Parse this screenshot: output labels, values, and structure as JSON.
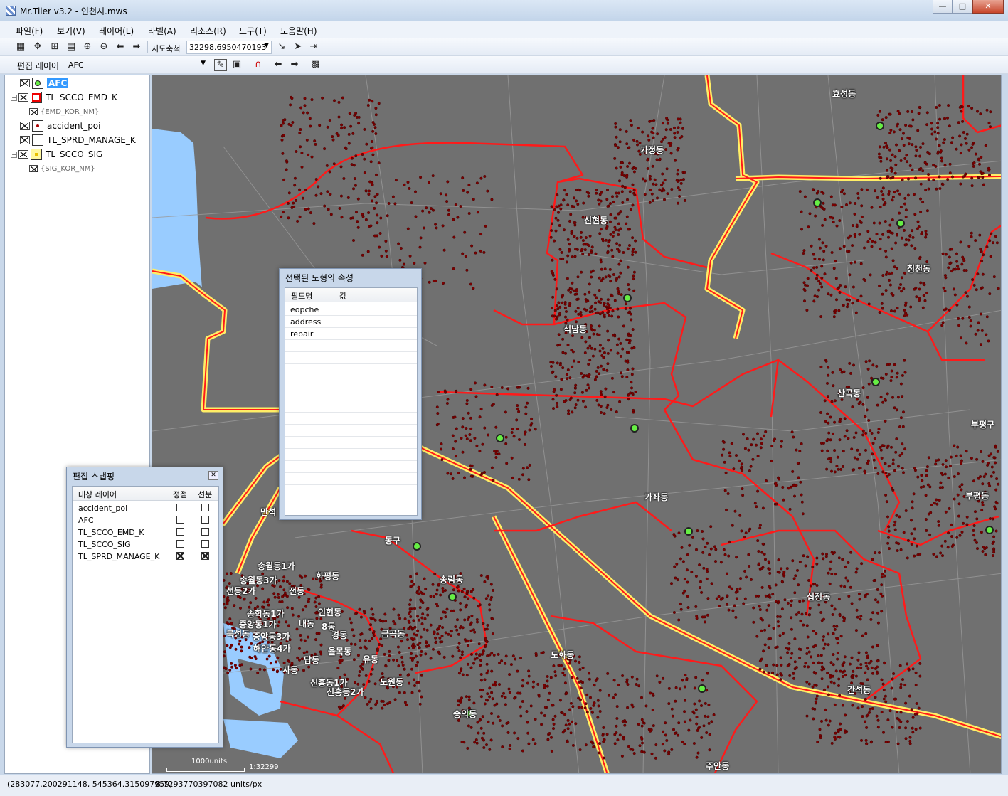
{
  "window": {
    "title": "Mr.Tiler v3.2 - 인천시.mws",
    "buttons": [
      "minimize",
      "maximize",
      "close"
    ]
  },
  "menu": [
    "파일(F)",
    "보기(V)",
    "레이어(L)",
    "라벨(A)",
    "리소스(R)",
    "도구(T)",
    "도움말(H)"
  ],
  "toolbar1": {
    "scale_label": "지도축척",
    "scale_value": "32298.6950470193",
    "icons": [
      "select-extent-icon",
      "pan-icon",
      "grid-icon",
      "table-icon",
      "zoom-in-icon",
      "zoom-out-icon",
      "back-icon",
      "forward-icon"
    ]
  },
  "toolbar2": {
    "edit_layer_label": "편집 레이어",
    "edit_layer_value": "AFC"
  },
  "layers": [
    {
      "name": "AFC",
      "selected": true,
      "symbol": "green-point"
    },
    {
      "name": "TL_SCCO_EMD_K",
      "symbol": "red-polygon",
      "expanded": true,
      "sublabel": "{EMD_KOR_NM}"
    },
    {
      "name": "accident_poi",
      "symbol": "red-point"
    },
    {
      "name": "TL_SPRD_MANAGE_K",
      "symbol": "empty"
    },
    {
      "name": "TL_SCCO_SIG",
      "symbol": "yellow-polygon",
      "expanded": true,
      "sublabel": "{SIG_KOR_NM}"
    }
  ],
  "map": {
    "labels": [
      "효성동",
      "가정동",
      "신현동",
      "청천동",
      "석남동",
      "산곡동",
      "부평구",
      "가좌동",
      "부평동",
      "송림동",
      "십정동",
      "도화동",
      "간석동",
      "숭의동",
      "주안동",
      "만석",
      "동구",
      "송월동1가",
      "송월동3가",
      "화평동",
      "선동2가",
      "전동",
      "송학동1가",
      "인현동",
      "중앙동1가",
      "내동",
      "8동",
      "중앙동3가",
      "경동",
      "해안동4가",
      "금곡동",
      "북성동",
      "답동",
      "율목동",
      "유동",
      "사동",
      "신흥동1가",
      "신흥동2가",
      "도원동"
    ],
    "scale_bar_label": "1000units",
    "scale_ratio": "1:32299"
  },
  "attr_dialog": {
    "title": "선택된 도형의 속성",
    "columns": [
      "필드명",
      "값"
    ],
    "rows": [
      {
        "field": "eopche",
        "value": ""
      },
      {
        "field": "address",
        "value": ""
      },
      {
        "field": "repair",
        "value": ""
      }
    ]
  },
  "snap_dialog": {
    "title": "편집 스냅핑",
    "columns": [
      "대상 레이어",
      "정점",
      "선분"
    ],
    "rows": [
      {
        "layer": "accident_poi",
        "vertex": false,
        "segment": false
      },
      {
        "layer": "AFC",
        "vertex": false,
        "segment": false
      },
      {
        "layer": "TL_SCCO_EMD_K",
        "vertex": false,
        "segment": false
      },
      {
        "layer": "TL_SCCO_SIG",
        "vertex": false,
        "segment": false
      },
      {
        "layer": "TL_SPRD_MANAGE_K",
        "vertex": true,
        "segment": true
      }
    ]
  },
  "status": {
    "coords": "(283077.200291148, 545364.315097959)",
    "resolution": "8.7293770397082 units/px"
  },
  "colors": {
    "map_bg": "#707070",
    "boundary_red": "#ff1a1a",
    "sig_yellow": "#ffee66",
    "afc_green": "#66ee44",
    "poi_dark_red": "#7a0000",
    "water": "#99ccff"
  }
}
